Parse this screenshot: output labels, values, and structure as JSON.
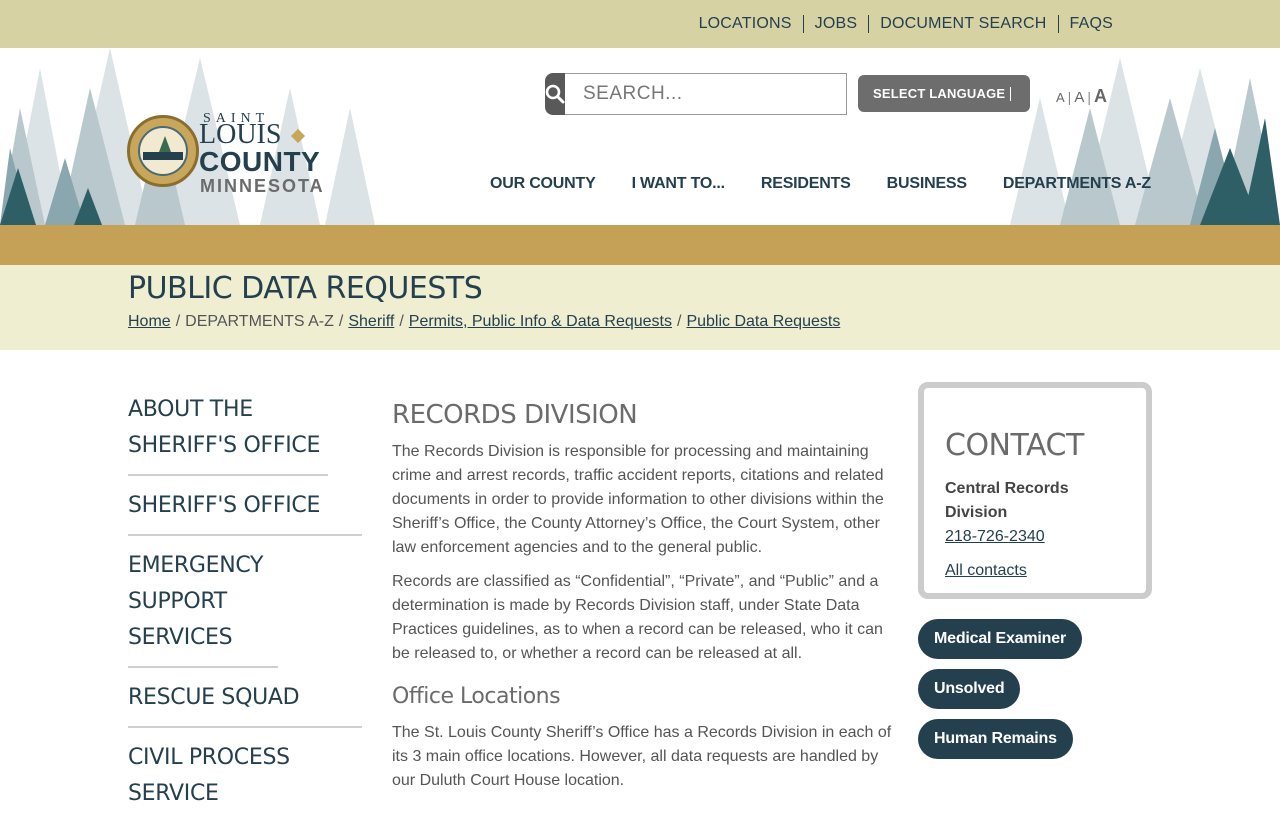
{
  "utility_nav": [
    "LOCATIONS",
    "JOBS",
    "DOCUMENT SEARCH",
    "FAQS"
  ],
  "logo": {
    "saint": "SAINT",
    "louis": "LOUIS",
    "county": "COUNTY",
    "state": "MINNESOTA",
    "seal_text": "SAINT LOUIS"
  },
  "search": {
    "placeholder": "SEARCH..."
  },
  "language": {
    "label": "SELECT LANGUAGE"
  },
  "text_size": {
    "small": "A",
    "medium": "A",
    "large": "A",
    "separator": "|"
  },
  "main_nav": [
    "OUR COUNTY",
    "I WANT TO...",
    "RESIDENTS",
    "BUSINESS",
    "DEPARTMENTS A-Z"
  ],
  "page": {
    "title": "PUBLIC DATA REQUESTS",
    "breadcrumb": [
      {
        "label": "Home",
        "link": true
      },
      {
        "label": "DEPARTMENTS A-Z",
        "link": false
      },
      {
        "label": "Sheriff",
        "link": true
      },
      {
        "label": "Permits, Public Info & Data Requests",
        "link": true
      },
      {
        "label": "Public Data Requests",
        "link": true
      }
    ],
    "breadcrumb_separator": "/"
  },
  "sidebar": {
    "items": [
      "ABOUT THE SHERIFF'S OFFICE",
      "SHERIFF'S OFFICE",
      "EMERGENCY SUPPORT SERVICES",
      "RESCUE SQUAD",
      "CIVIL PROCESS SERVICE"
    ]
  },
  "content": {
    "heading": "RECORDS DIVISION",
    "para1": "The Records Division is responsible for processing and maintaining crime and arrest records, traffic accident reports, citations and related documents in order to provide information to other divisions within the Sheriff’s Office, the County Attorney’s Office, the Court System, other law enforcement agencies and to the general public.",
    "para2": "Records are classified as “Confidential”, “Private”, and “Public” and a determination is made by Records Division staff, under State Data Practices guidelines, as to when a record can be released, who it can be released to, or whether a record can be released at all.",
    "subheading": "Office Locations",
    "para3": "The St. Louis County Sheriff’s Office has a Records Division in each of its 3 main office locations. However, all data requests are handled by our Duluth Court House location."
  },
  "contact": {
    "heading": "CONTACT",
    "org": "Central Records Division",
    "phone": "218-726-2340",
    "all_contacts": "All contacts"
  },
  "quick_links": [
    "Medical Examiner",
    "Unsolved",
    "Human Remains"
  ],
  "colors": {
    "topbar": "#d6d2a3",
    "navy": "#24404f",
    "gold": "#c5a158",
    "title_band": "#f0eed0"
  }
}
